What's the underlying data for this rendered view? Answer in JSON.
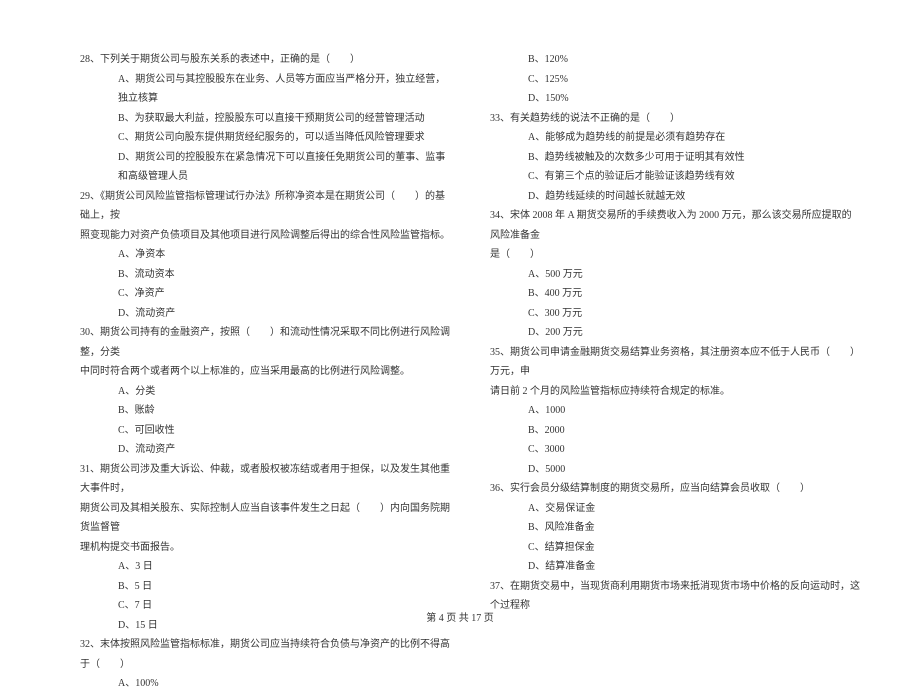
{
  "footer": "第 4 页  共 17 页",
  "left": {
    "q28": {
      "stem": "28、下列关于期货公司与股东关系的表述中，正确的是（　　）",
      "a": "A、期货公司与其控股股东在业务、人员等方面应当严格分开，独立经营，独立核算",
      "b": "B、为获取最大利益，控股股东可以直接干预期货公司的经营管理活动",
      "c": "C、期货公司向股东提供期货经纪服务的，可以适当降低风险管理要求",
      "d": "D、期货公司的控股股东在紧急情况下可以直接任免期货公司的董事、监事和高级管理人员"
    },
    "q29": {
      "stem1": "29、《期货公司风险监管指标管理试行办法》所称净资本是在期货公司（　　）的基础上，按",
      "stem2": "照变现能力对资产负债项目及其他项目进行风险调整后得出的综合性风险监管指标。",
      "a": "A、净资本",
      "b": "B、流动资本",
      "c": "C、净资产",
      "d": "D、流动资产"
    },
    "q30": {
      "stem1": "30、期货公司持有的金融资产，按照（　　）和流动性情况采取不同比例进行风险调整，分类",
      "stem2": "中同时符合两个或者两个以上标准的，应当采用最高的比例进行风险调整。",
      "a": "A、分类",
      "b": "B、账龄",
      "c": "C、可回收性",
      "d": "D、流动资产"
    },
    "q31": {
      "stem1": "31、期货公司涉及重大诉讼、仲裁，或者股权被冻结或者用于担保，以及发生其他重大事件时，",
      "stem2": "期货公司及其相关股东、实际控制人应当自该事件发生之日起（　　）内向国务院期货监督管",
      "stem3": "理机构提交书面报告。",
      "a": "A、3 日",
      "b": "B、5 日",
      "c": "C、7 日",
      "d": "D、15 日"
    },
    "q32": {
      "stem": "32、末体按照风险监管指标标准，期货公司应当持续符合负债与净资产的比例不得高于（　　）",
      "a": "A、100%"
    }
  },
  "right": {
    "q32cont": {
      "b": "B、120%",
      "c": "C、125%",
      "d": "D、150%"
    },
    "q33": {
      "stem": "33、有关趋势线的说法不正确的是（　　）",
      "a": "A、能够成为趋势线的前提是必须有趋势存在",
      "b": "B、趋势线被触及的次数多少可用于证明其有效性",
      "c": "C、有第三个点的验证后才能验证该趋势线有效",
      "d": "D、趋势线延续的时间越长就越无效"
    },
    "q34": {
      "stem1": "34、宋体 2008 年 A 期货交易所的手续费收入为 2000 万元，那么该交易所应提取的风险准备金",
      "stem2": "是（　　）",
      "a": "A、500 万元",
      "b": "B、400 万元",
      "c": "C、300 万元",
      "d": "D、200 万元"
    },
    "q35": {
      "stem1": "35、期货公司申请金融期货交易结算业务资格，其注册资本应不低于人民币（　　）万元，申",
      "stem2": "请日前 2 个月的风险监管指标应持续符合规定的标准。",
      "a": "A、1000",
      "b": "B、2000",
      "c": "C、3000",
      "d": "D、5000"
    },
    "q36": {
      "stem": "36、实行会员分级结算制度的期货交易所，应当向结算会员收取（　　）",
      "a": "A、交易保证金",
      "b": "B、风险准备金",
      "c": "C、结算担保金",
      "d": "D、结算准备金"
    },
    "q37": {
      "stem": "37、在期货交易中，当现货商利用期货市场来抵消现货市场中价格的反向运动时，这个过程称"
    }
  }
}
